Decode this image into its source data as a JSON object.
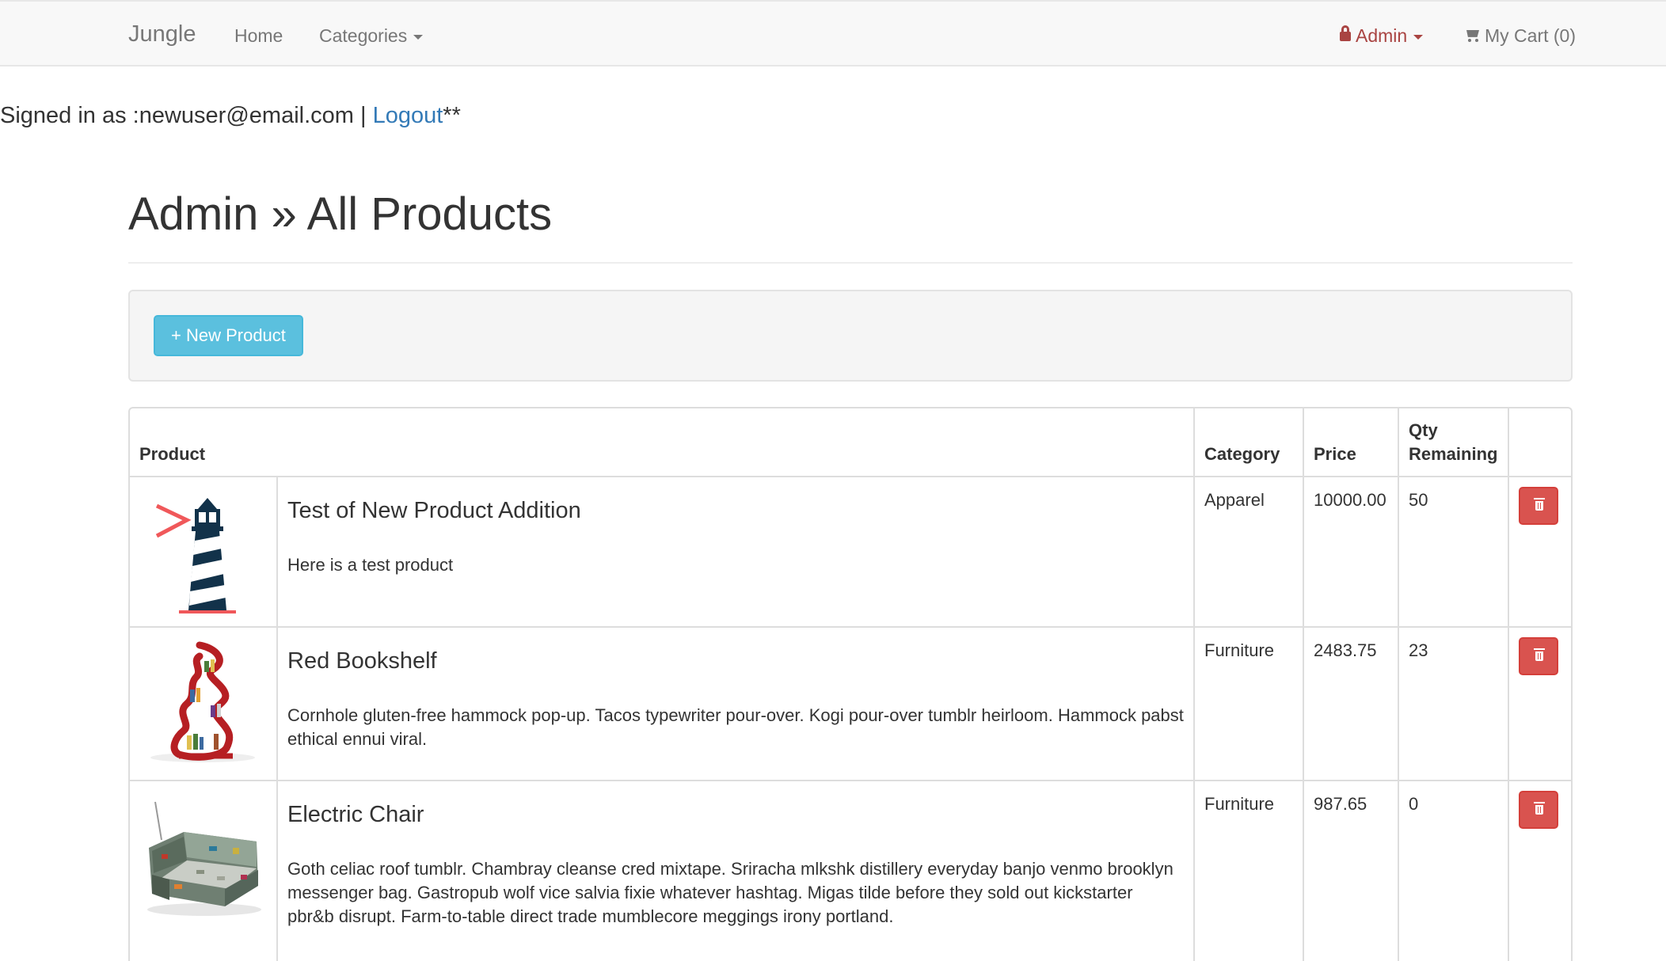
{
  "navbar": {
    "brand": "Jungle",
    "home": "Home",
    "categories": "Categories",
    "admin": "Admin",
    "cart": "My Cart (0)"
  },
  "session": {
    "signed_in_prefix": "Signed in as :newuser@email.com | ",
    "logout": "Logout",
    "suffix": "**"
  },
  "page": {
    "title": "Admin » All Products",
    "new_product_button": "+ New Product"
  },
  "table": {
    "headers": {
      "product": "Product",
      "category": "Category",
      "price": "Price",
      "qty_line1": "Qty",
      "qty_line2": "Remaining"
    },
    "rows": [
      {
        "name": "Test of New Product Addition",
        "description": "Here is a test product",
        "category": "Apparel",
        "price": "10000.00",
        "qty": "50",
        "image_icon": "lighthouse-icon"
      },
      {
        "name": "Red Bookshelf",
        "description": "Cornhole gluten-free hammock pop-up. Tacos typewriter pour-over. Kogi pour-over tumblr heirloom. Hammock pabst ethical ennui viral.",
        "category": "Furniture",
        "price": "2483.75",
        "qty": "23",
        "image_icon": "bookshelf-icon"
      },
      {
        "name": "Electric Chair",
        "description": "Goth celiac roof tumblr. Chambray cleanse cred mixtape. Sriracha mlkshk distillery everyday banjo venmo brooklyn messenger bag. Gastropub wolf vice salvia fixie whatever hashtag. Migas tilde before they sold out kickstarter pbr&b disrupt. Farm-to-table direct trade mumblecore meggings irony portland.",
        "category": "Furniture",
        "price": "987.65",
        "qty": "0",
        "image_icon": "armchair-icon"
      }
    ]
  },
  "colors": {
    "link": "#337ab7",
    "admin": "#a94442",
    "info_button": "#5bc0de",
    "danger_button": "#d9534f"
  }
}
